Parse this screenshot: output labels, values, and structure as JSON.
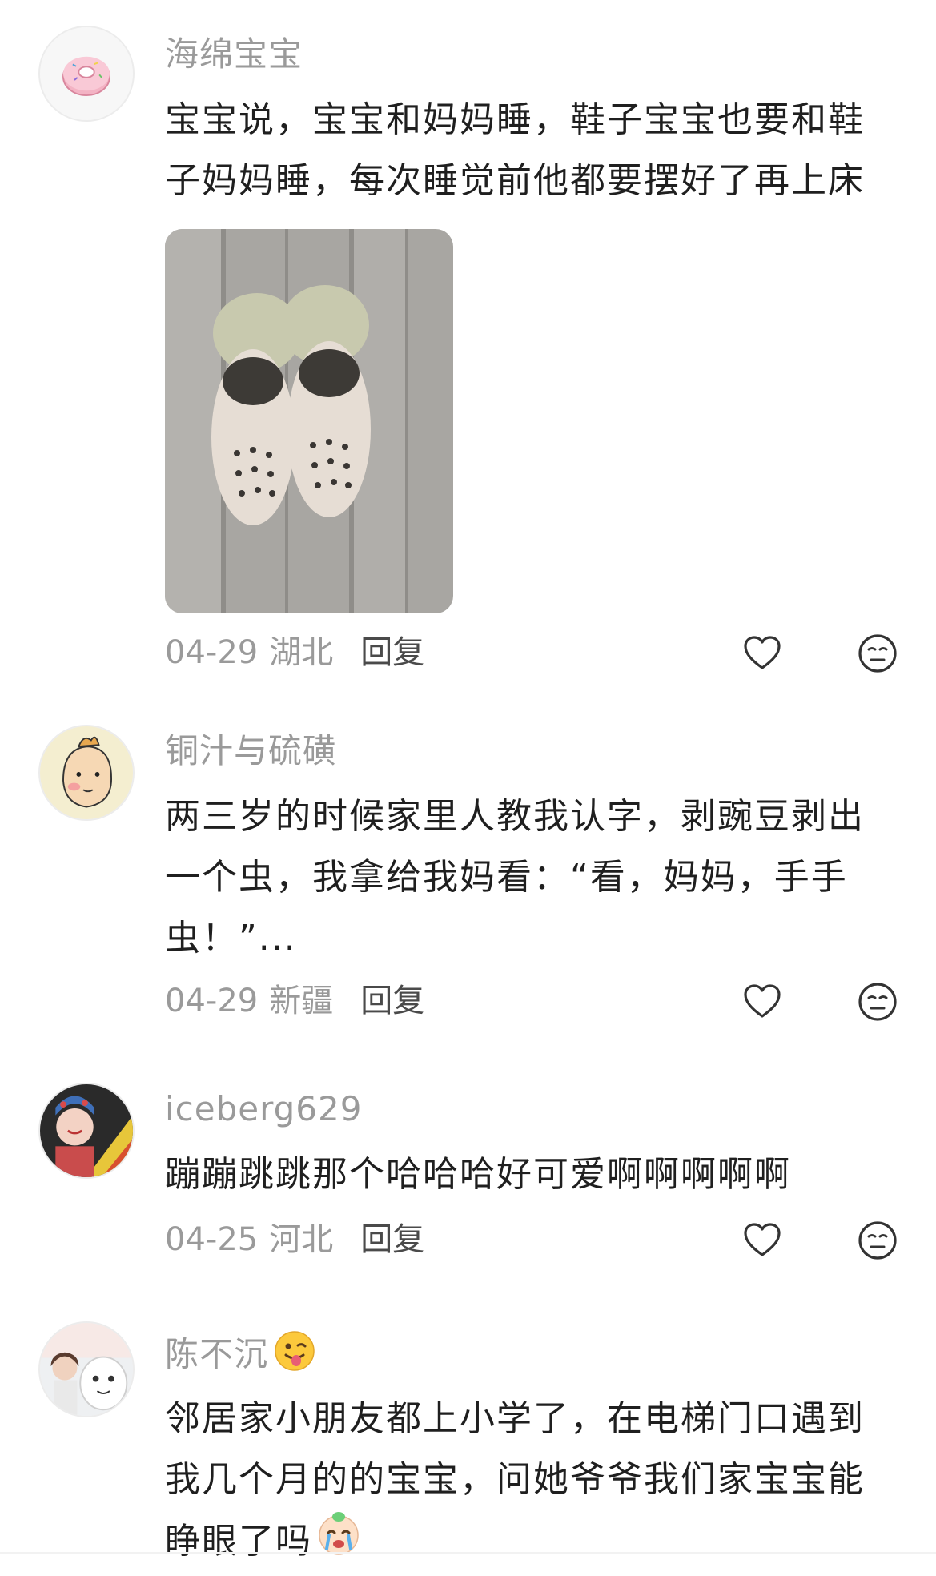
{
  "comments": [
    {
      "username": "海绵宝宝",
      "avatar": "donut-avatar",
      "text": "宝宝说，宝宝和妈妈睡，鞋子宝宝也要和鞋子妈妈睡，每次睡觉前他都要摆好了再上床",
      "image": "sandals-on-floor-photo",
      "date": "04-29",
      "region": "湖北",
      "reply_label": "回复"
    },
    {
      "username": "铜汁与硫磺",
      "avatar": "cartoon-boy-avatar",
      "text": "两三岁的时候家里人教我认字，剥豌豆剥出一个虫，我拿给我妈看：“看，妈妈，手手虫！”...",
      "date": "04-29",
      "region": "新疆",
      "reply_label": "回复"
    },
    {
      "username": "iceberg629",
      "avatar": "opera-fan-avatar",
      "text": "蹦蹦跳跳那个哈哈哈好可爱啊啊啊啊啊",
      "date": "04-25",
      "region": "河北",
      "reply_label": "回复"
    },
    {
      "username": "陈不沉",
      "username_emoji": "winking-tongue-emoji",
      "avatar": "photo-collage-avatar",
      "text": "邻居家小朋友都上小学了，在电梯门口遇到我几个月的的宝宝，问她爷爷我们家宝宝能睁眼了吗",
      "text_trailing_emoji": "crying-baby-emoji"
    }
  ],
  "icons": {
    "like": "heart-outline-icon",
    "dislike": "neutral-face-icon"
  },
  "colors": {
    "username": "#9a9a9a",
    "body_text": "#1f1f1f",
    "meta": "#9a9a9a",
    "reply": "#4a4a4a",
    "icon": "#333333"
  }
}
